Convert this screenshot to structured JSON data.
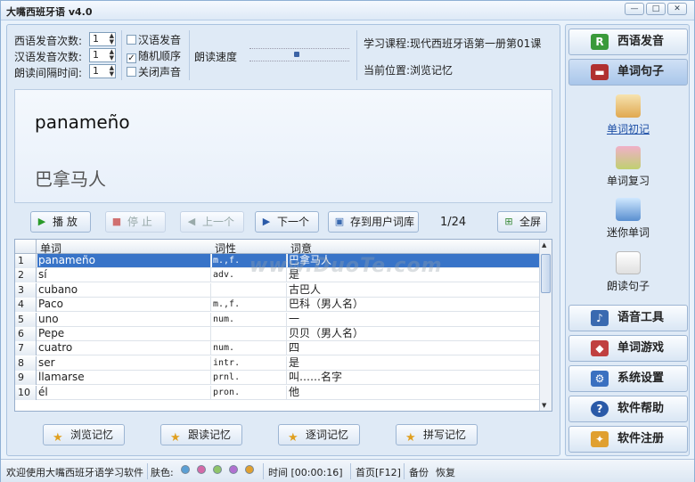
{
  "window": {
    "title": "大嘴西班牙语 v4.0"
  },
  "settings": {
    "es_count_label": "西语发音次数:",
    "es_count": "1",
    "zh_count_label": "汉语发音次数:",
    "zh_count": "1",
    "interval_label": "朗读间隔时间:",
    "interval": "1",
    "chk_zh": "汉语发音",
    "chk_zh_on": false,
    "chk_random": "随机顺序",
    "chk_random_on": true,
    "chk_mute": "关闭声音",
    "chk_mute_on": false,
    "speed_label": "朗读速度",
    "speed_level": 0.5,
    "course_label": "学习课程:",
    "course": "现代西班牙语第一册第01课",
    "pos_label": "当前位置:",
    "position": "浏览记忆"
  },
  "card": {
    "word": "panameño",
    "translation": "巴拿马人"
  },
  "toolbar": {
    "play": "播 放",
    "stop": "停 止",
    "prev": "上一个",
    "next": "下一个",
    "save": "存到用户词库",
    "counter": "1/24",
    "fullscreen": "全屏"
  },
  "table": {
    "headers": [
      "单词",
      "词性",
      "词意"
    ],
    "rows": [
      {
        "n": "1",
        "word": "panameño",
        "pos": "m.,f.",
        "meaning": "巴拿马人"
      },
      {
        "n": "2",
        "word": "sí",
        "pos": "adv.",
        "meaning": "是"
      },
      {
        "n": "3",
        "word": "cubano",
        "pos": "",
        "meaning": "古巴人"
      },
      {
        "n": "4",
        "word": "Paco",
        "pos": "m.,f.",
        "meaning": "巴科（男人名）"
      },
      {
        "n": "5",
        "word": "uno",
        "pos": "num.",
        "meaning": "一"
      },
      {
        "n": "6",
        "word": "Pepe",
        "pos": "",
        "meaning": "贝贝（男人名）"
      },
      {
        "n": "7",
        "word": "cuatro",
        "pos": "num.",
        "meaning": "四"
      },
      {
        "n": "8",
        "word": "ser",
        "pos": "intr.",
        "meaning": "是"
      },
      {
        "n": "9",
        "word": "llamarse",
        "pos": "prnl.",
        "meaning": "叫……名字"
      },
      {
        "n": "10",
        "word": "él",
        "pos": "pron.",
        "meaning": "他"
      }
    ]
  },
  "modes": {
    "browse": "浏览记忆",
    "follow": "跟读记忆",
    "each": "逐词记忆",
    "spell": "拼写记忆"
  },
  "sidebar": {
    "es_pron": "西语发音",
    "words": "单词句子",
    "sub1": "单词初记",
    "sub2": "单词复习",
    "sub3": "迷你单词",
    "sub4": "朗读句子",
    "tools": "语音工具",
    "games": "单词游戏",
    "settings": "系统设置",
    "help": "软件帮助",
    "register": "软件注册"
  },
  "status": {
    "welcome": "欢迎使用大嘴西班牙语学习软件",
    "skin_label": "肤色:",
    "skin_colors": [
      "#5a9fd4",
      "#d46aa8",
      "#8fc46a",
      "#b070d0",
      "#e0a030"
    ],
    "time": "时间 [00:00:16]",
    "home": "首页[F12]",
    "backup": "备份",
    "restore": "恢复"
  },
  "watermark": {
    "text": "www.DuoTe.com"
  }
}
